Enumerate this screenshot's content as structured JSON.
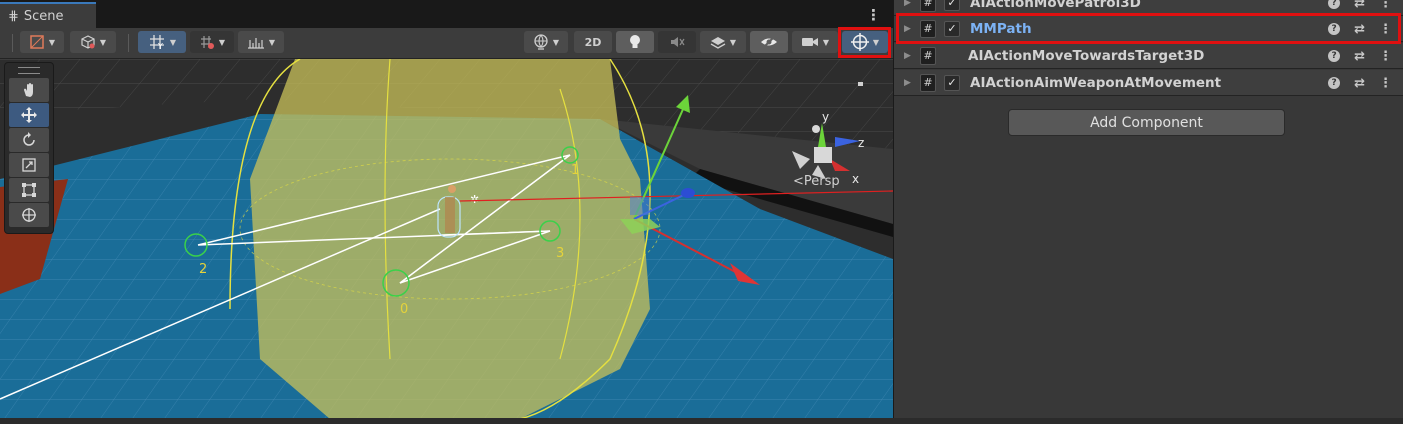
{
  "scene": {
    "tab_title": "Scene",
    "tab_icon": "grid-icon",
    "toolbar": {
      "toggle_2d": "2D",
      "gizmo_highlight_color": "#e01010"
    },
    "persp_label": "Persp",
    "axis_labels": {
      "x": "x",
      "y": "y",
      "z": "z"
    },
    "waypoints": [
      {
        "label": "0",
        "color": "#e5d33b"
      },
      {
        "label": "1",
        "color": "#e5d33b"
      },
      {
        "label": "2",
        "color": "#e5d33b"
      },
      {
        "label": "3",
        "color": "#e5d33b"
      }
    ],
    "tools": [
      "hand-icon",
      "move-icon",
      "rotate-icon",
      "scale-icon",
      "rect-icon",
      "transform-icon"
    ]
  },
  "inspector": {
    "components": [
      {
        "name": "AIActionMovePatrol3D",
        "checked": true,
        "highlighted": false
      },
      {
        "name": "MMPath",
        "checked": true,
        "highlighted": true
      },
      {
        "name": "AIActionMoveTowardsTarget3D",
        "checked": false,
        "highlighted": false
      },
      {
        "name": "AIActionAimWeaponAtMovement",
        "checked": true,
        "highlighted": false
      }
    ],
    "add_component_label": "Add Component",
    "highlight_color": "#e01010",
    "selected_name_color": "#7cb2f4"
  }
}
